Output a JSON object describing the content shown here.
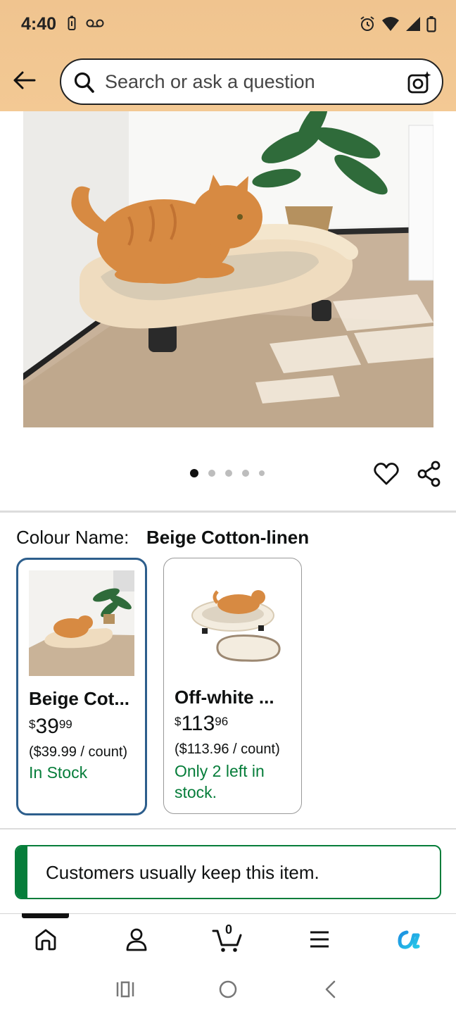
{
  "status_bar": {
    "time": "4:40",
    "left_icons": [
      "battery-saver-icon",
      "voicemail-icon"
    ],
    "right_icons": [
      "alarm-icon",
      "wifi-icon",
      "signal-icon",
      "battery-icon"
    ]
  },
  "header": {
    "back_icon": "arrow-left-icon",
    "search_placeholder": "Search or ask a question",
    "camera_icon": "camera-search-icon",
    "background_color": "#f0c48f"
  },
  "product_image": {
    "description_icon": "cat-bed-photo",
    "carousel_count": 5,
    "carousel_active_index": 0
  },
  "colour_selector": {
    "label": "Colour Name:",
    "selected_value": "Beige Cotton-linen",
    "options": [
      {
        "title": "Beige Cot...",
        "price_symbol": "$",
        "price_whole": "39",
        "price_fraction": "99",
        "unit_price": "($39.99 / count)",
        "stock": "In Stock",
        "selected": true
      },
      {
        "title": "Off-white ...",
        "price_symbol": "$",
        "price_whole": "113",
        "price_fraction": "96",
        "unit_price": "($113.96 / count)",
        "stock": "Only 2 left in stock.",
        "selected": false
      }
    ]
  },
  "keep_banner": {
    "text": "Customers usually keep this item.",
    "accent_color": "#067d3a"
  },
  "bottom_nav": {
    "items": [
      "home-icon",
      "account-icon",
      "cart-icon",
      "menu-icon",
      "rufus-ai-icon"
    ],
    "cart_count": "0",
    "active_index": 0
  },
  "system_nav": [
    "recents-icon",
    "home-circle-icon",
    "back-chevron-icon"
  ]
}
